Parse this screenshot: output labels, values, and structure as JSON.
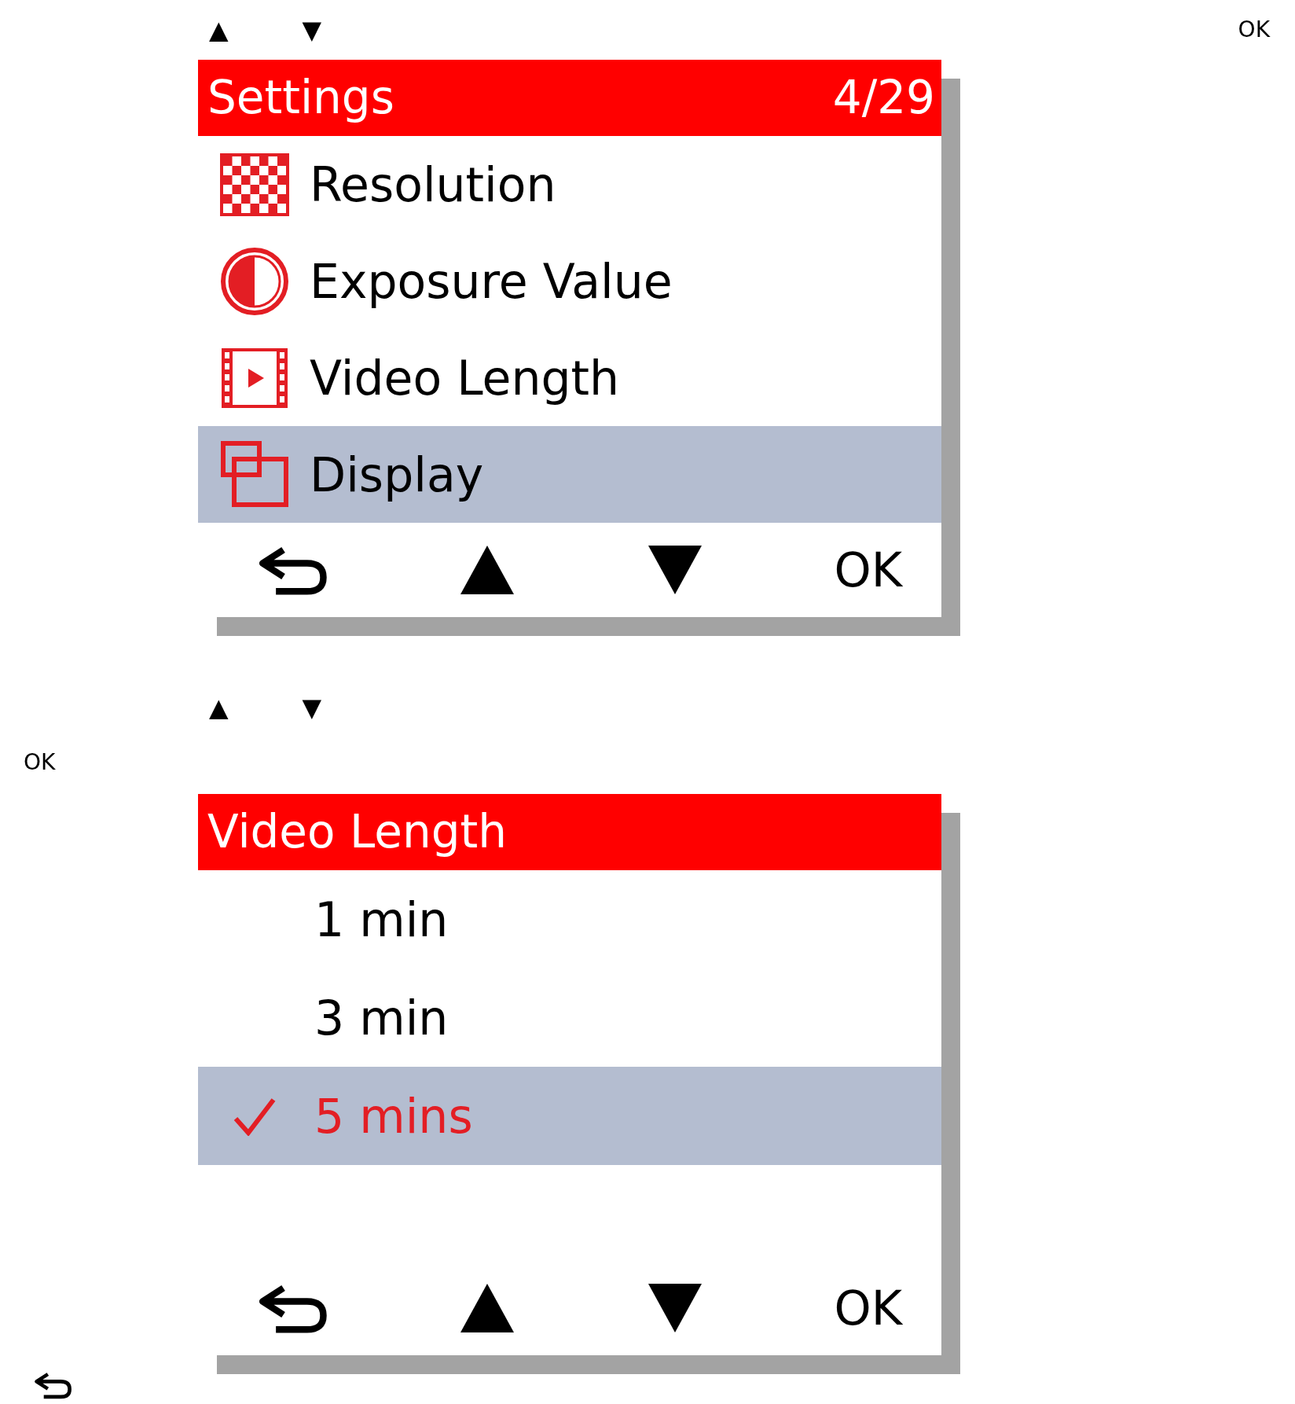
{
  "marks_top": {
    "up": "▲",
    "down": "▼",
    "ok": "OK"
  },
  "settings_screen": {
    "title": "Settings",
    "counter": "4/29",
    "items": [
      {
        "label": "Resolution",
        "kind": "resolution",
        "selected": false
      },
      {
        "label": "Exposure Value",
        "kind": "exposure",
        "selected": false
      },
      {
        "label": "Video Length",
        "kind": "video",
        "selected": false
      },
      {
        "label": "Display",
        "kind": "display",
        "selected": true
      }
    ],
    "footer": {
      "ok": "OK"
    }
  },
  "marks_middle": {
    "up": "▲",
    "down": "▼",
    "ok": "OK"
  },
  "video_length_screen": {
    "title": "Video Length",
    "options": [
      {
        "label": "1 min",
        "selected": false
      },
      {
        "label": "3 min",
        "selected": false
      },
      {
        "label": "5 mins",
        "selected": true
      }
    ],
    "footer": {
      "ok": "OK"
    }
  }
}
